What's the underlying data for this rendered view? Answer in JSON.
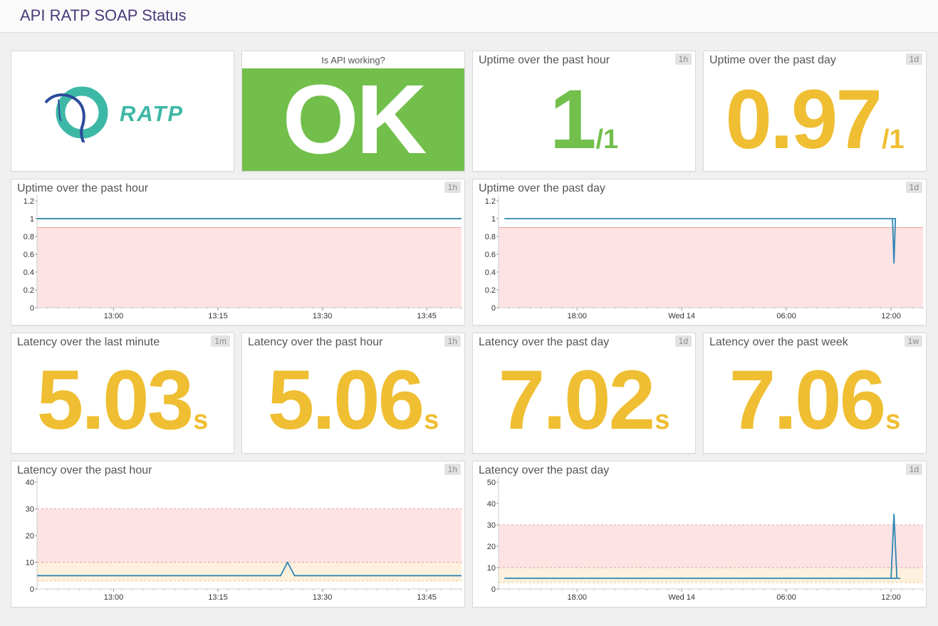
{
  "page": {
    "title": "API RATP SOAP Status"
  },
  "widgets": {
    "logo": {
      "text": "RATP"
    },
    "status": {
      "label": "Is API working?",
      "value": "OK",
      "color": "#72bf4b"
    },
    "uptime_hour_value": {
      "title": "Uptime over the past hour",
      "badge": "1h",
      "value": "1",
      "suffix": "/1",
      "color": "#72bf4b"
    },
    "uptime_day_value": {
      "title": "Uptime over the past day",
      "badge": "1d",
      "value": "0.97",
      "suffix": "/1",
      "color": "#efbe32"
    },
    "uptime_hour_chart": {
      "title": "Uptime over the past hour",
      "badge": "1h"
    },
    "uptime_day_chart": {
      "title": "Uptime over the past day",
      "badge": "1d"
    },
    "latency_minute": {
      "title": "Latency over the last minute",
      "badge": "1m",
      "value": "5.03",
      "suffix": "s"
    },
    "latency_hour": {
      "title": "Latency over the past hour",
      "badge": "1h",
      "value": "5.06",
      "suffix": "s"
    },
    "latency_day": {
      "title": "Latency over the past day",
      "badge": "1d",
      "value": "7.02",
      "suffix": "s"
    },
    "latency_week": {
      "title": "Latency over the past week",
      "badge": "1w",
      "value": "7.06",
      "suffix": "s"
    },
    "latency_hour_chart": {
      "title": "Latency over the past hour",
      "badge": "1h"
    },
    "latency_day_chart": {
      "title": "Latency over the past day",
      "badge": "1d"
    }
  },
  "colors": {
    "line": "#2e86b5",
    "flat_line": "#2a7ea0",
    "red_band": "#fde3e3",
    "yellow_band": "#fdf0dc",
    "threshold_red": "#e8a0a0",
    "threshold_yellow": "#e8c98a",
    "good": "#72bf4b",
    "warn": "#efbe32"
  },
  "chart_data": [
    {
      "id": "uptime_hour",
      "type": "line",
      "ylim": [
        0,
        1.2
      ],
      "yticks": [
        "0",
        "0.2",
        "0.4",
        "0.6",
        "0.8",
        "1",
        "1.2"
      ],
      "xlim": [
        "12:49",
        "13:50"
      ],
      "xticks": [
        "13:00",
        "13:15",
        "13:30",
        "13:45"
      ],
      "bands": [
        {
          "from": 0,
          "to": 0.9,
          "kind": "red"
        }
      ],
      "thresholds": [],
      "series": [
        {
          "x": [
            "12:49",
            "13:50"
          ],
          "y": [
            1,
            1
          ]
        }
      ]
    },
    {
      "id": "uptime_day",
      "type": "line",
      "ylim": [
        0,
        1.2
      ],
      "yticks": [
        "0",
        "0.2",
        "0.4",
        "0.6",
        "0.8",
        "1",
        "1.2"
      ],
      "xlim": [
        "13:30",
        "13:50 Wed 14"
      ],
      "xticks": [
        "18:00",
        "Wed 14",
        "06:00",
        "12:00"
      ],
      "bands": [
        {
          "from": 0,
          "to": 0.9,
          "kind": "red"
        }
      ],
      "thresholds": [],
      "series": [
        {
          "x": [
            "12:00",
            "12:05",
            "12:10",
            "12:15",
            "13:50"
          ],
          "y": [
            1,
            1,
            0.5,
            1,
            1
          ]
        }
      ]
    },
    {
      "id": "latency_hour",
      "type": "line",
      "ylim": [
        0,
        40
      ],
      "yticks": [
        "0",
        "10",
        "20",
        "30",
        "40"
      ],
      "xlim": [
        "12:49",
        "13:50"
      ],
      "xticks": [
        "13:00",
        "13:15",
        "13:30",
        "13:45"
      ],
      "bands": [
        {
          "from": 10,
          "to": 30,
          "kind": "red"
        },
        {
          "from": 3,
          "to": 10,
          "kind": "yellow"
        }
      ],
      "thresholds": [
        30,
        10,
        3
      ],
      "series": [
        {
          "x": [
            "12:49",
            "13:24",
            "13:25",
            "13:26",
            "13:50"
          ],
          "y": [
            5,
            5,
            10,
            5,
            5
          ]
        }
      ]
    },
    {
      "id": "latency_day",
      "type": "line",
      "ylim": [
        0,
        50
      ],
      "yticks": [
        "0",
        "10",
        "20",
        "30",
        "40",
        "50"
      ],
      "xlim": [
        "13:30",
        "13:50 Wed 14"
      ],
      "xticks": [
        "18:00",
        "Wed 14",
        "06:00",
        "12:00"
      ],
      "bands": [
        {
          "from": 10,
          "to": 30,
          "kind": "red"
        },
        {
          "from": 3,
          "to": 10,
          "kind": "yellow"
        }
      ],
      "thresholds": [
        30,
        10,
        3
      ],
      "series": [
        {
          "x": [
            "12:00",
            "12:10",
            "12:20",
            "12:30",
            "13:50"
          ],
          "y": [
            5,
            35,
            5,
            5,
            5
          ]
        }
      ]
    }
  ]
}
